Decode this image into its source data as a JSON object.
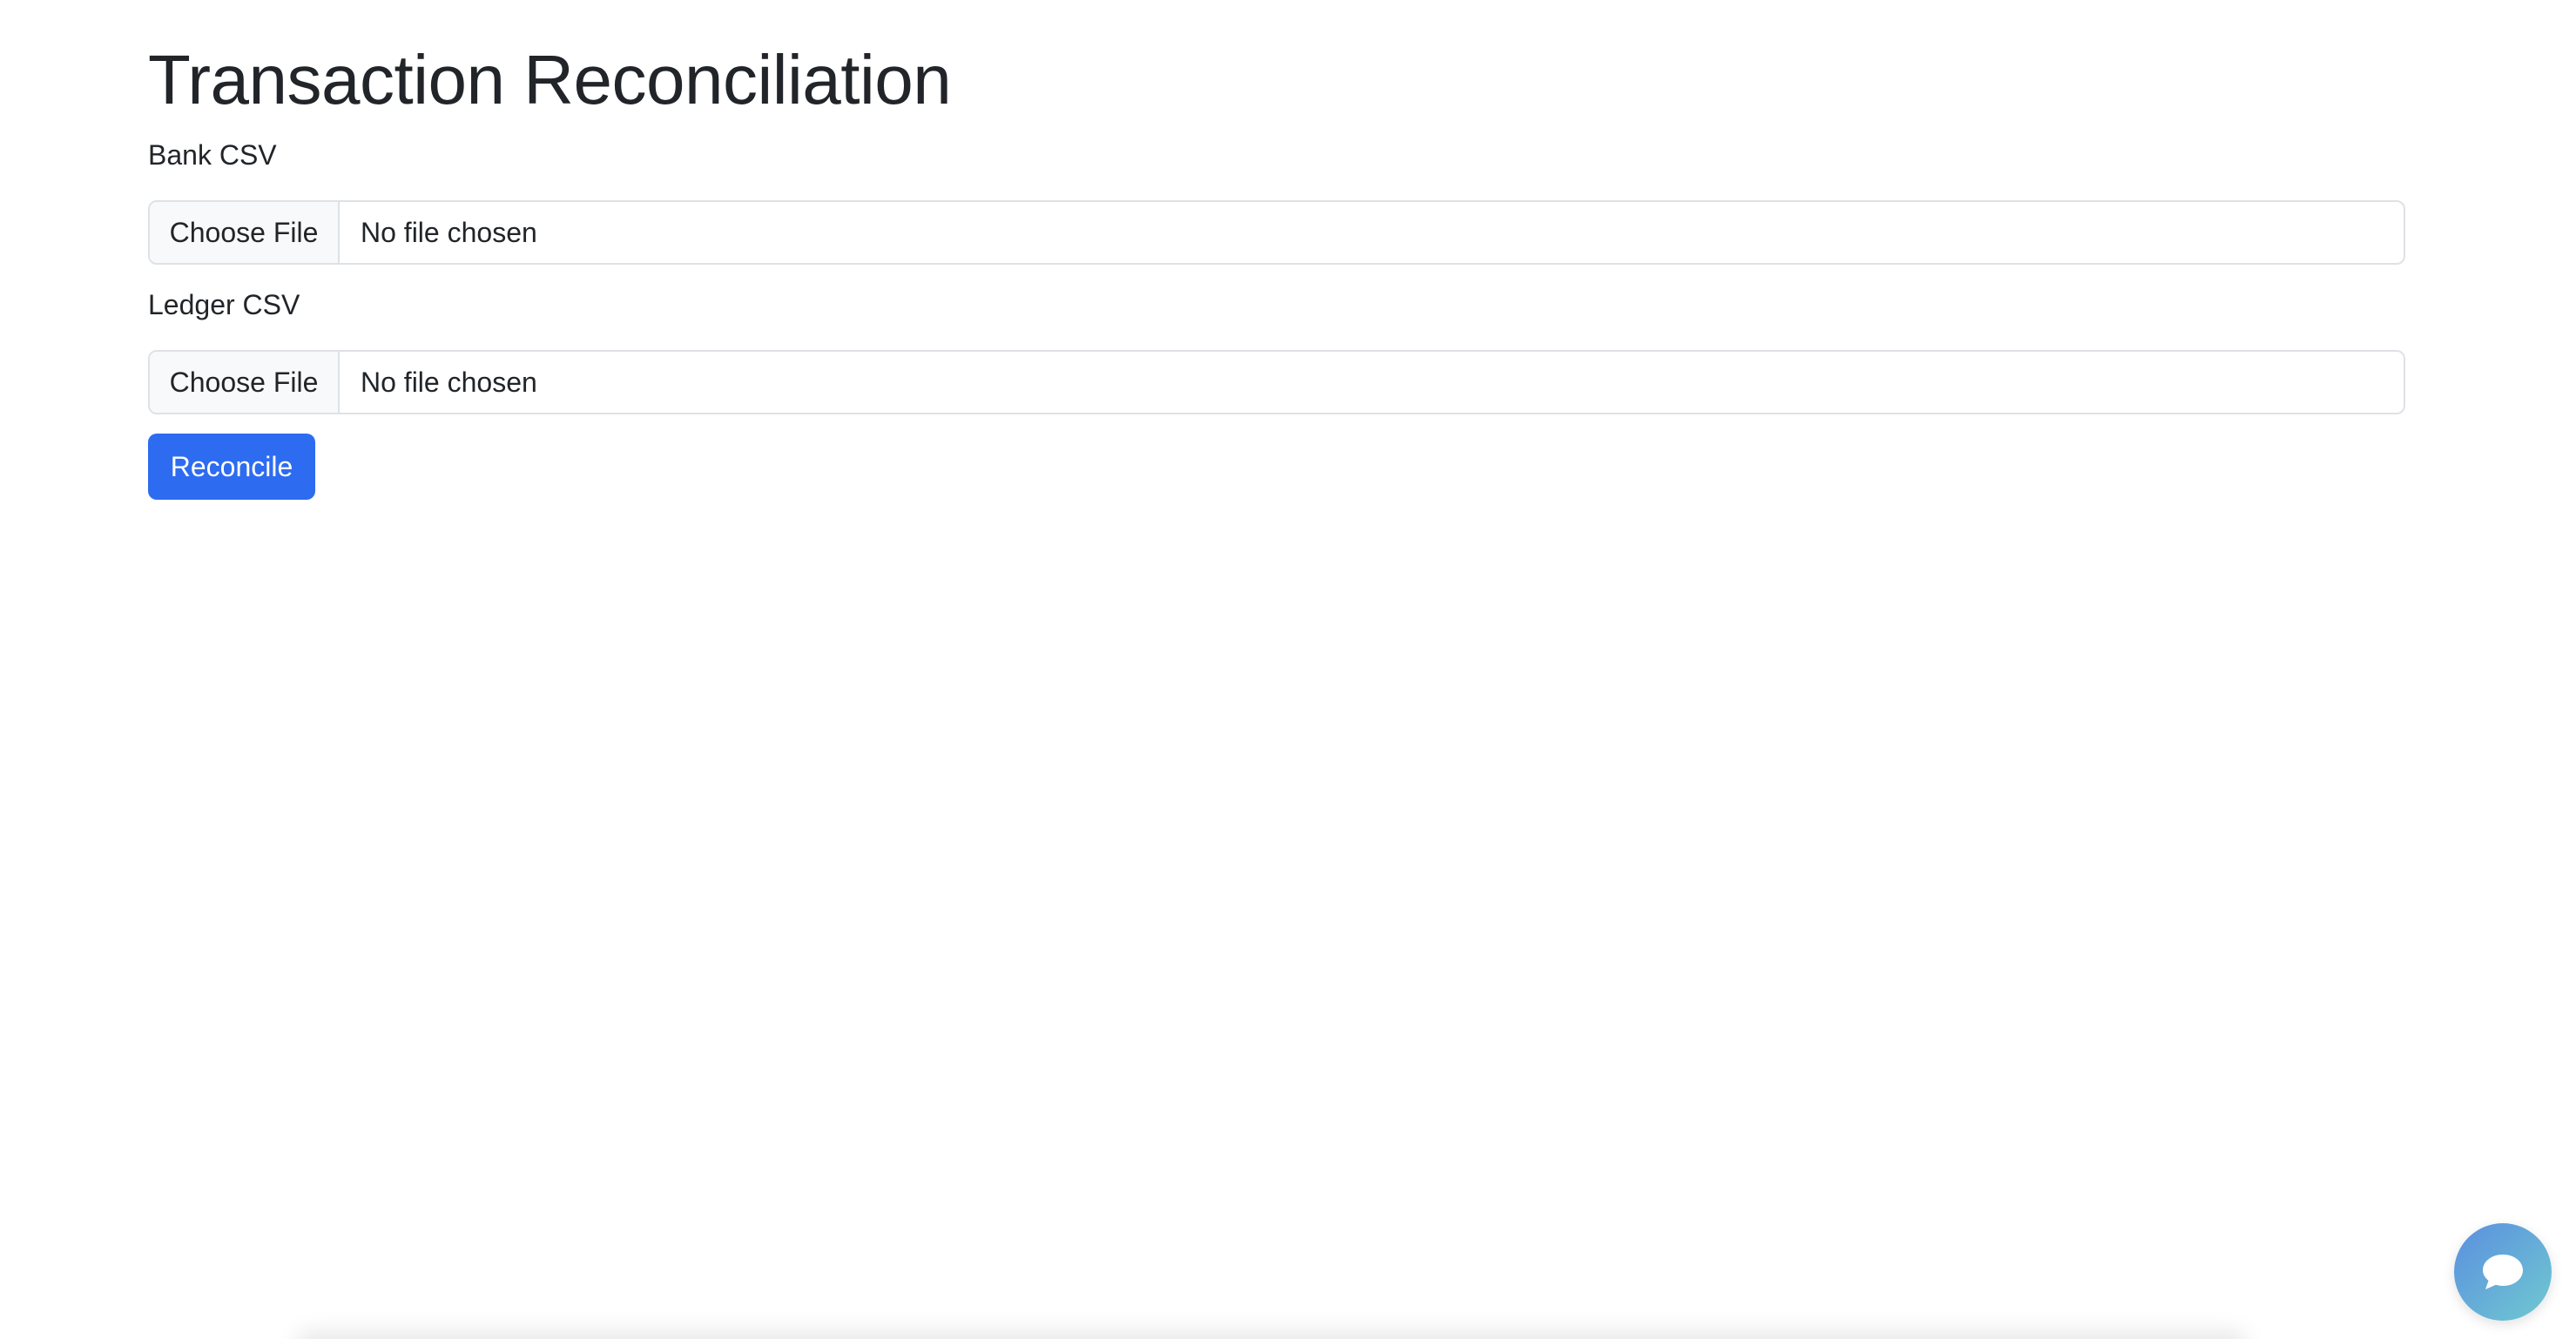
{
  "page": {
    "title": "Transaction Reconciliation"
  },
  "form": {
    "bank": {
      "label": "Bank CSV",
      "button_label": "Choose File",
      "status": "No file chosen"
    },
    "ledger": {
      "label": "Ledger CSV",
      "button_label": "Choose File",
      "status": "No file chosen"
    },
    "submit_label": "Reconcile"
  },
  "chat": {
    "icon": "chat-bubble-icon"
  },
  "colors": {
    "primary": "#2d6cf0",
    "text": "#212529",
    "border": "#dee2e6",
    "file_button_bg": "#f8f9fa"
  }
}
